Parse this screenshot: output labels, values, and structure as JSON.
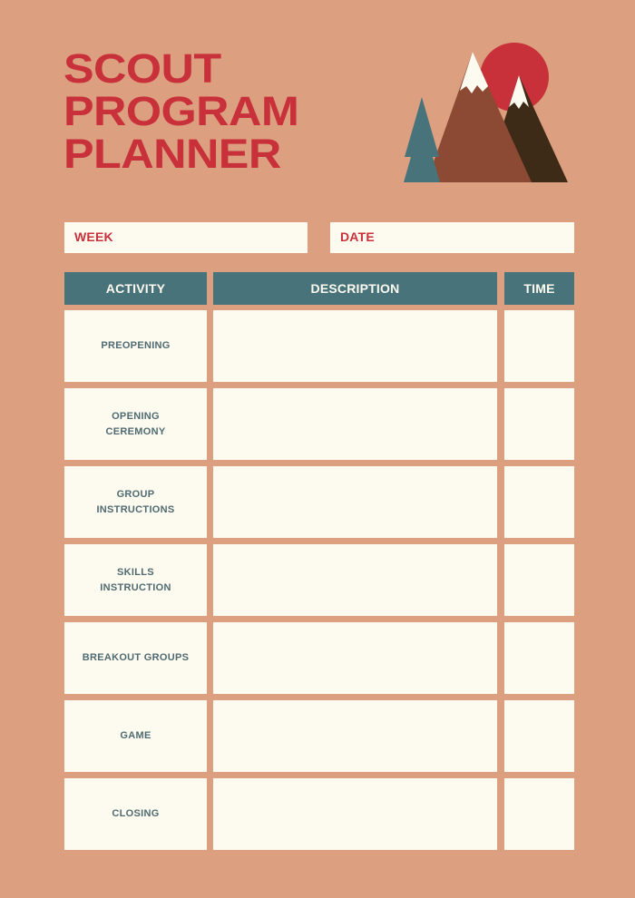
{
  "title": {
    "lines": [
      "SCOUT",
      "PROGRAM",
      "PLANNER"
    ]
  },
  "logo": {
    "icon": "mountains-sun-tree-icon",
    "colors": {
      "sun": "#c9313a",
      "mountain_large": "#8c4a34",
      "mountain_small": "#3d2a17",
      "snow": "#fdfbf0",
      "tree": "#48737a"
    }
  },
  "fields": {
    "week_label": "WEEK",
    "date_label": "DATE"
  },
  "table": {
    "headers": [
      "ACTIVITY",
      "DESCRIPTION",
      "TIME"
    ],
    "rows": [
      {
        "activity": "PREOPENING",
        "description": "",
        "time": ""
      },
      {
        "activity": "OPENING\nCEREMONY",
        "description": "",
        "time": ""
      },
      {
        "activity": "GROUP\nINSTRUCTIONS",
        "description": "",
        "time": ""
      },
      {
        "activity": "SKILLS\nINSTRUCTION",
        "description": "",
        "time": ""
      },
      {
        "activity": "BREAKOUT GROUPS",
        "description": "",
        "time": ""
      },
      {
        "activity": "GAME",
        "description": "",
        "time": ""
      },
      {
        "activity": "CLOSING",
        "description": "",
        "time": ""
      }
    ]
  },
  "colors": {
    "background": "#dc9f80",
    "accent_red": "#c9313a",
    "header_teal": "#48737a",
    "cell_cream": "#fdfbf0",
    "activity_text": "#4f6b71"
  }
}
